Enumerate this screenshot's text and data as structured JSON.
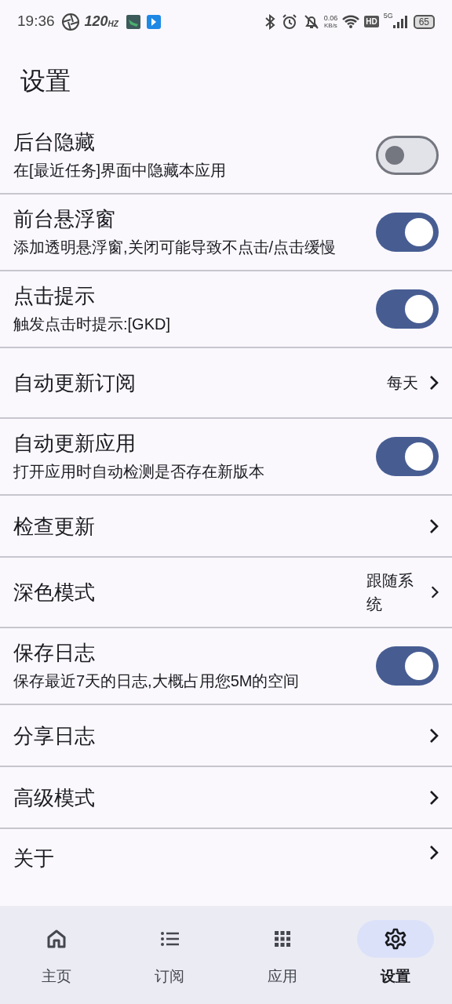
{
  "status_bar": {
    "time": "19:36",
    "refresh_rate": "120",
    "refresh_unit": "HZ",
    "net_speed": "0.06",
    "net_unit": "KB/s",
    "hd": "HD",
    "network": "5G",
    "battery": "65"
  },
  "title": "设置",
  "settings": [
    {
      "kind": "switch",
      "title": "后台隐藏",
      "subtitle": "在[最近任务]界面中隐藏本应用",
      "on": false
    },
    {
      "kind": "switch",
      "title": "前台悬浮窗",
      "subtitle": "添加透明悬浮窗,关闭可能导致不点击/点击缓慢",
      "on": true
    },
    {
      "kind": "switch",
      "title": "点击提示",
      "subtitle": "触发点击时提示:[GKD]",
      "on": true
    },
    {
      "kind": "link",
      "title": "自动更新订阅",
      "value": "每天"
    },
    {
      "kind": "switch",
      "title": "自动更新应用",
      "subtitle": "打开应用时自动检测是否存在新版本",
      "on": true
    },
    {
      "kind": "link",
      "title": "检查更新"
    },
    {
      "kind": "link",
      "title": "深色模式",
      "value": "跟随系统"
    },
    {
      "kind": "switch",
      "title": "保存日志",
      "subtitle": "保存最近7天的日志,大概占用您5M的空间",
      "on": true
    },
    {
      "kind": "link",
      "title": "分享日志"
    },
    {
      "kind": "link",
      "title": "高级模式"
    },
    {
      "kind": "link",
      "title": "关于"
    }
  ],
  "nav": [
    {
      "kind": "home",
      "label": "主页",
      "selected": false
    },
    {
      "kind": "list",
      "label": "订阅",
      "selected": false
    },
    {
      "kind": "grid",
      "label": "应用",
      "selected": false
    },
    {
      "kind": "gear",
      "label": "设置",
      "selected": true
    }
  ]
}
